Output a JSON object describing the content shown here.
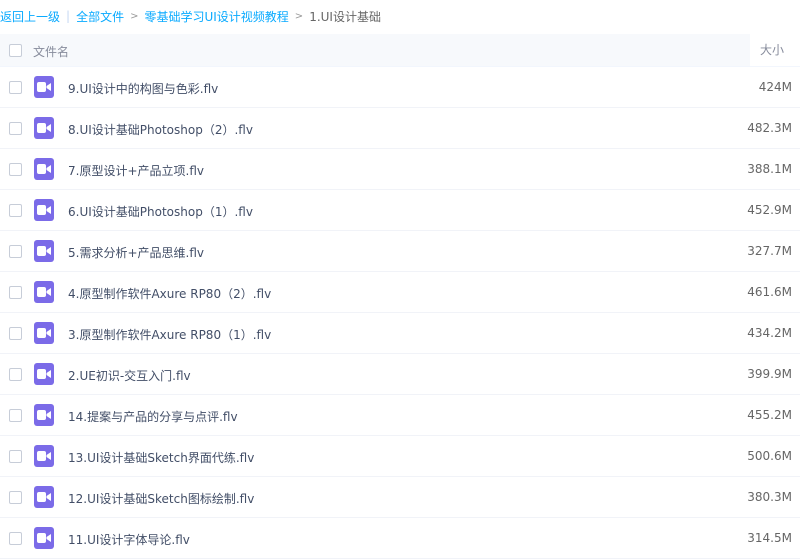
{
  "breadcrumb": {
    "back": "返回上一级",
    "separator": "|",
    "all_files": "全部文件",
    "arrow": ">",
    "folder": "零基础学习UI设计视频教程",
    "current": "1.UI设计基础"
  },
  "header": {
    "name_label": "文件名",
    "size_label": "大小"
  },
  "colors": {
    "link": "#09aaff",
    "video_icon": "#7b6be8"
  },
  "files": [
    {
      "name": "9.UI设计中的构图与色彩.flv",
      "size": "424M",
      "icon": "video-icon"
    },
    {
      "name": "8.UI设计基础Photoshop（2）.flv",
      "size": "482.3M",
      "icon": "video-icon"
    },
    {
      "name": "7.原型设计+产品立项.flv",
      "size": "388.1M",
      "icon": "video-icon"
    },
    {
      "name": "6.UI设计基础Photoshop（1）.flv",
      "size": "452.9M",
      "icon": "video-icon"
    },
    {
      "name": "5.需求分析+产品思维.flv",
      "size": "327.7M",
      "icon": "video-icon"
    },
    {
      "name": "4.原型制作软件Axure RP80（2）.flv",
      "size": "461.6M",
      "icon": "video-icon"
    },
    {
      "name": "3.原型制作软件Axure RP80（1）.flv",
      "size": "434.2M",
      "icon": "video-icon"
    },
    {
      "name": "2.UE初识-交互入门.flv",
      "size": "399.9M",
      "icon": "video-icon"
    },
    {
      "name": "14.提案与产品的分享与点评.flv",
      "size": "455.2M",
      "icon": "video-icon"
    },
    {
      "name": "13.UI设计基础Sketch界面代练.flv",
      "size": "500.6M",
      "icon": "video-icon"
    },
    {
      "name": "12.UI设计基础Sketch图标绘制.flv",
      "size": "380.3M",
      "icon": "video-icon"
    },
    {
      "name": "11.UI设计字体导论.flv",
      "size": "314.5M",
      "icon": "video-icon"
    }
  ]
}
